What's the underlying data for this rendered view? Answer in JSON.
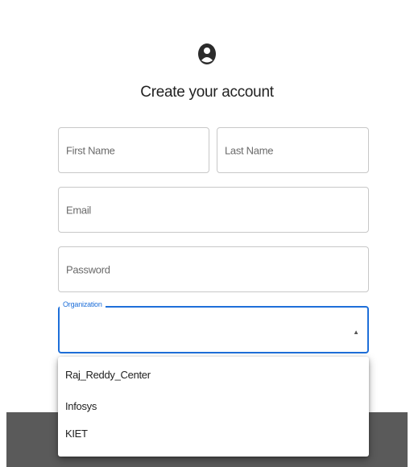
{
  "form": {
    "title": "Create your account",
    "first_name_placeholder": "First Name",
    "last_name_placeholder": "Last Name",
    "email_placeholder": "Email",
    "password_placeholder": "Password",
    "organization_label": "Organization",
    "organization_value": ""
  },
  "dropdown": {
    "options": [
      "Raj_Reddy_Center",
      "Infosys",
      "KIET"
    ]
  },
  "icons": {
    "avatar": "account-circle-icon",
    "dropdown_arrow": "triangle-up-icon"
  },
  "colors": {
    "accent": "#1e6fd9",
    "backdrop": "#5a5a5a"
  }
}
